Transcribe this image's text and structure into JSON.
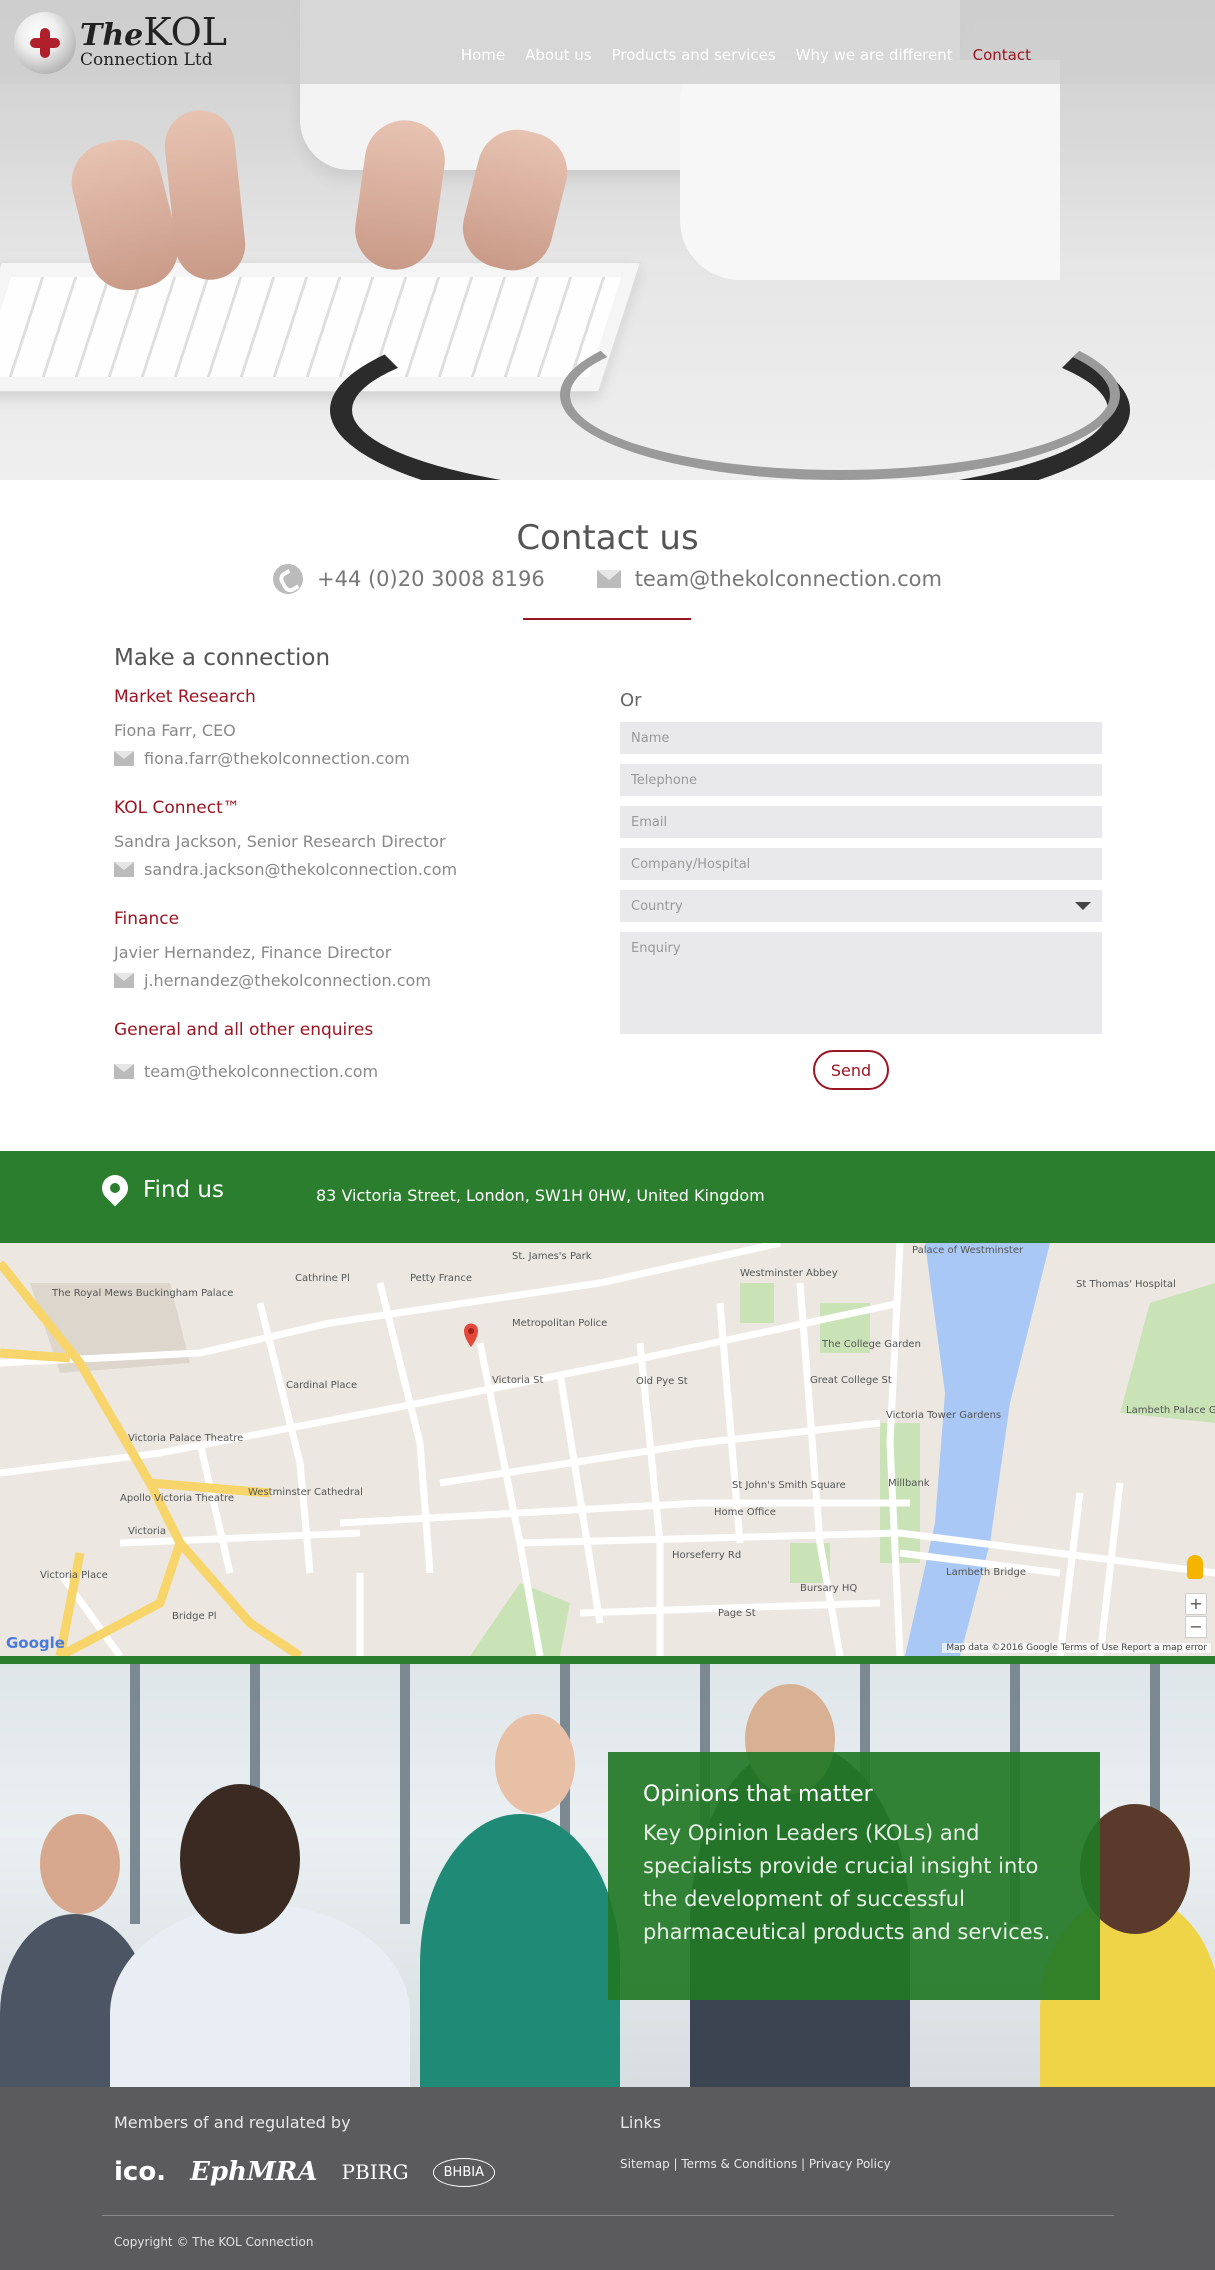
{
  "brand": {
    "line1_the": "The",
    "line1_kol": "KOL",
    "line2": "Connection Ltd"
  },
  "nav": [
    {
      "label": "Home"
    },
    {
      "label": "About us"
    },
    {
      "label": "Products and services"
    },
    {
      "label": "Why we are different"
    },
    {
      "label": "Contact",
      "active": true
    }
  ],
  "contact": {
    "title": "Contact us",
    "phone": "+44 (0)20 3008 8196",
    "email": "team@thekolconnection.com",
    "make_connection": "Make a connection",
    "groups": [
      {
        "dept": "Market Research",
        "person": "Fiona Farr, CEO",
        "email": "fiona.farr@thekolconnection.com"
      },
      {
        "dept": "KOL Connect™",
        "person": "Sandra Jackson, Senior Research Director",
        "email": "sandra.jackson@thekolconnection.com"
      },
      {
        "dept": "Finance",
        "person": "Javier Hernandez, Finance Director",
        "email": "j.hernandez@thekolconnection.com"
      },
      {
        "dept": "General and all other enquires",
        "person": "",
        "email": "team@thekolconnection.com"
      }
    ]
  },
  "form": {
    "or": "Or",
    "name_placeholder": "Name",
    "telephone_placeholder": "Telephone",
    "email_placeholder": "Email",
    "company_placeholder": "Company/Hospital",
    "country_selected": "Country",
    "enquiry_placeholder": "Enquiry",
    "send_label": "Send"
  },
  "find_us": {
    "title": "Find us",
    "address": "83 Victoria Street, London, SW1H 0HW, United Kingdom"
  },
  "map": {
    "labels": [
      "The Royal Mews Buckingham Palace",
      "Cathrine Pl",
      "Petty France",
      "St. James's Park",
      "Westminster Abbey",
      "Palace of Westminster",
      "St Thomas' Hospital",
      "Metropolitan Police",
      "Cardinal Place",
      "Victoria St",
      "Old Pye St",
      "Great College St",
      "Lambeth Palace Gardens",
      "Victoria Palace Theatre",
      "Apollo Victoria Theatre",
      "Westminster Cathedral",
      "Victoria",
      "Victoria Place",
      "St John's Smith Square",
      "Home Office",
      "Horseferry Rd",
      "Lambeth Bridge",
      "Bursary HQ",
      "Page St",
      "Millbank",
      "Victoria Tower Gardens",
      "The College Garden",
      "Bridge Pl"
    ],
    "google": "Google",
    "footer": "Map data ©2016 Google   Terms of Use   Report a map error"
  },
  "opinions": {
    "title": "Opinions that matter",
    "text": "Key Opinion Leaders (KOLs) and specialists provide crucial insight into the development of successful pharmaceutical products and services."
  },
  "footer": {
    "members_title": "Members of and regulated by",
    "logos": [
      "ico.",
      "EphMRA",
      "PBIRG",
      "BHBIA"
    ],
    "links_title": "Links",
    "links": [
      "Sitemap",
      "Terms & Conditions",
      "Privacy Policy"
    ],
    "separator": " | ",
    "copyright": "Copyright © The KOL Connection"
  },
  "colors": {
    "accent": "#9b1522",
    "green": "#2a7e2d",
    "footer": "#5b5b5d",
    "field": "#e9e9eb"
  }
}
